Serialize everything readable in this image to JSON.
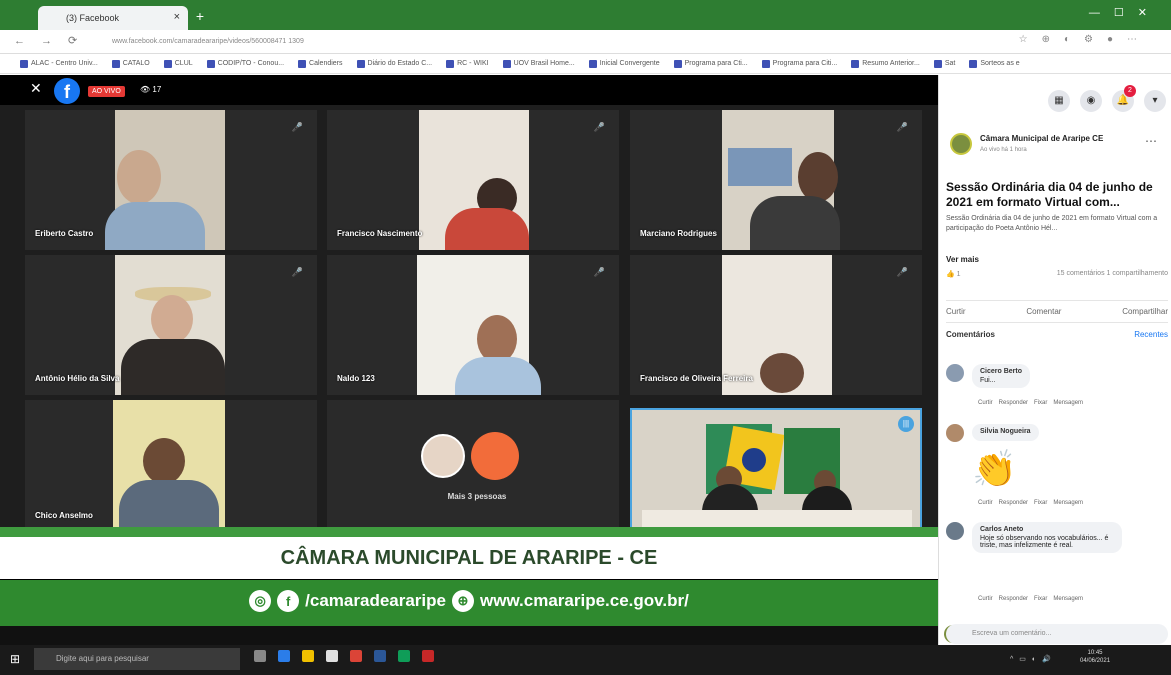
{
  "browser": {
    "tab_title": "(3) Facebook",
    "url": "www.facebook.com/camaradeararipe/videos/560008471 1309",
    "bookmarks": [
      "ALAC - Centro Univ...",
      "CATALO",
      "CLUL",
      "CODIP/TO - Conou...",
      "Calendiers",
      "Diário do Estado C...",
      "RC - WIKI",
      "UOV Brasil Home...",
      "Inicial Convergente",
      "Programa para Cti...",
      "Programa para Citi...",
      "Resumo Anterior...",
      "Sat",
      "Sorteos as e"
    ]
  },
  "video": {
    "live_label": "AO VIVO",
    "viewer_count": "17",
    "participants": [
      {
        "name": "Eriberto Castro"
      },
      {
        "name": "Francisco Nascimento"
      },
      {
        "name": "Marciano Rodrigues"
      },
      {
        "name": "Antônio Hélio da Silva"
      },
      {
        "name": "Naldo 123"
      },
      {
        "name": "Francisco de Oliveira Ferreira"
      },
      {
        "name": "Chico Anselmo"
      },
      {
        "name": "Mais 3 pessoas"
      }
    ],
    "banner_title": "CÂMARA MUNICIPAL DE ARARIPE - CE",
    "social_handle": "/camaradeararipe",
    "website": "www.cmararipe.ce.gov.br/"
  },
  "sidebar": {
    "page_name": "Câmara Municipal de Araripe CE",
    "post_meta": "Ao vivo há 1 hora",
    "post_title": "Sessão Ordinária dia 04 de junho de 2021 em formato Virtual com...",
    "post_description": "Sessão Ordinária dia 04 de junho de 2021 em formato Virtual com a participação do Poeta Antônio Hél...",
    "see_more": "Ver mais",
    "reaction_count": "1",
    "comment_share_count": "15 comentários 1 compartilhamento",
    "actions": [
      "Curtir",
      "Comentar",
      "Compartilhar"
    ],
    "comments_label": "Comentários",
    "comments_filter": "Recentes",
    "comments": [
      {
        "author": "Cicero Berto",
        "text": "Fui...",
        "actions": [
          "Curtir",
          "Responder",
          "Fixar",
          "Mensagem"
        ]
      },
      {
        "author": "Silvia Nogueira",
        "text": "",
        "actions": [
          "Curtir",
          "Responder",
          "Fixar",
          "Mensagem"
        ]
      },
      {
        "author": "Carlos Aneto",
        "text": "Hoje só observando nos vocabulários... é triste, mas infelizmente é real.",
        "actions": [
          "Curtir",
          "Responder",
          "Fixar",
          "Mensagem"
        ]
      }
    ],
    "comment_placeholder": "Escreva um comentário..."
  },
  "taskbar": {
    "search_placeholder": "Digite aqui para pesquisar",
    "time": "10:45",
    "date": "04/06/2021"
  },
  "colors": {
    "brand_green": "#2f8a2f",
    "facebook_blue": "#1877f2",
    "live_red": "#e53935"
  }
}
